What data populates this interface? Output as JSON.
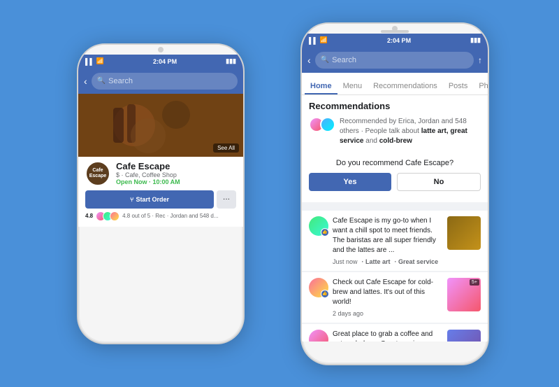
{
  "background_color": "#4A90D9",
  "back_phone": {
    "status_bar": {
      "signal": "▌▌▌",
      "wifi": "WiFi",
      "time": "2:04 PM",
      "battery": "▮▮▮"
    },
    "nav": {
      "back_icon": "‹",
      "search_placeholder": "Search"
    },
    "hero": {
      "see_all": "See All"
    },
    "business": {
      "logo_text": "Cafe\nEscape",
      "name": "Cafe Escape",
      "type": "$ · Cafe, Coffee Shop",
      "open_text": "Open Now · 10:00 AM",
      "start_order_label": "Start Order",
      "fork_icon": "⑂",
      "more_icon": "⊕",
      "rating": "4.8",
      "rating_detail": "4.8 out of 5 · Rec · Jordan and 548 d..."
    }
  },
  "front_phone": {
    "status_bar": {
      "signal": "▌▌▌",
      "wifi": "WiFi",
      "time": "2:04 PM",
      "battery": "▮▮▮▮"
    },
    "nav": {
      "back_icon": "‹",
      "search_placeholder": "Search",
      "share_icon": "↑"
    },
    "tabs": [
      {
        "label": "Home",
        "active": true
      },
      {
        "label": "Menu",
        "active": false
      },
      {
        "label": "Recommendations",
        "active": false
      },
      {
        "label": "Posts",
        "active": false
      },
      {
        "label": "Ph",
        "active": false
      }
    ],
    "recommendations": {
      "title": "Recommendations",
      "rec_summary": "Recommended by Erica, Jordan and 548 others · People talk about ",
      "rec_bold1": "latte art, great service",
      "rec_and": " and ",
      "rec_bold2": "cold-brew",
      "question": "Do you recommend Cafe Escape?",
      "yes_label": "Yes",
      "no_label": "No"
    },
    "reviews": [
      {
        "text": "Cafe Escape is my go-to when I want a chill spot to meet friends. The baristas are all super friendly and the lattes are ...",
        "time": "Just now",
        "tags": [
          "Latte art",
          "Great service"
        ],
        "has_thumb": true,
        "thumb_color": "coffee"
      },
      {
        "text": "Check out Cafe Escape for cold-brew and lattes. It's out of this world!",
        "time": "2 days ago",
        "tags": [],
        "has_thumb": true,
        "thumb_badge": "5+",
        "thumb_color": "pink"
      },
      {
        "text": "Great place to grab a coffee and get work done. Great service, atmosphere, and people. Love the latte art too!",
        "time": "",
        "tags": [],
        "has_thumb": true,
        "thumb_color": "blue"
      }
    ]
  }
}
